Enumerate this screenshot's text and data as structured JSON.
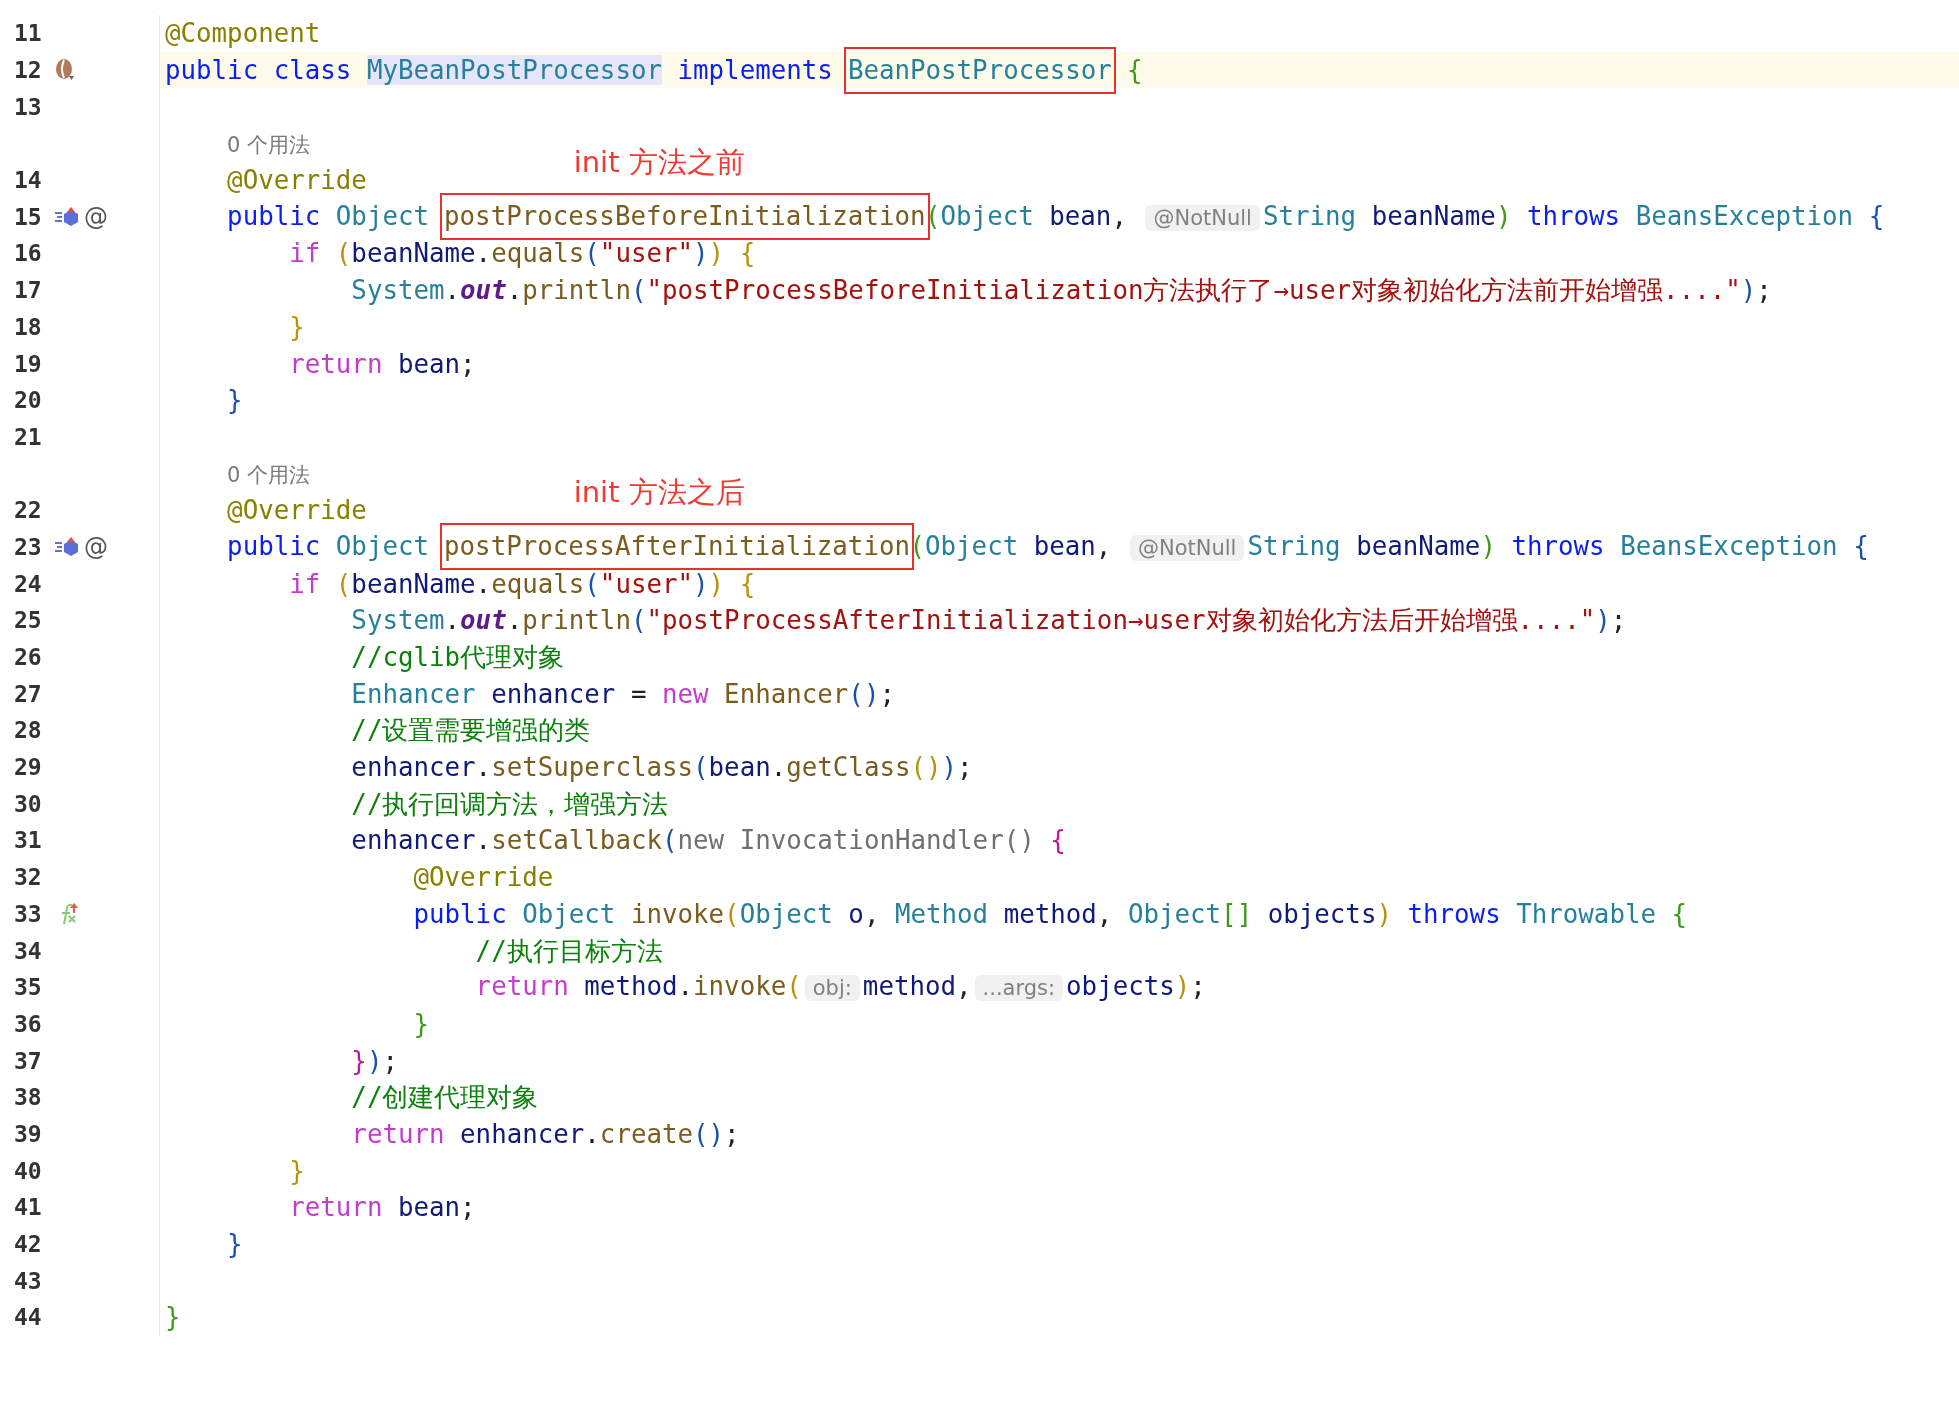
{
  "editor": {
    "lines": [
      {
        "kind": "code",
        "number": "11",
        "current": false,
        "words": [
          [
            {
              "text": "@Component",
              "kind": "ann"
            }
          ]
        ]
      },
      {
        "kind": "code",
        "number": "12",
        "current": true,
        "gutter": [
          {
            "kind": "bean"
          }
        ],
        "words": [
          [
            {
              "text": "public",
              "kind": "kw"
            }
          ],
          [
            {
              "text": "class",
              "kind": "kw"
            }
          ],
          [
            {
              "text": "MyBeanPostProcessor",
              "kind": "decl"
            }
          ],
          [
            {
              "text": "implements",
              "kind": "kw"
            }
          ],
          [
            {
              "text": "BeanPostProcessor",
              "kind": "type",
              "boxed": true
            }
          ],
          [
            {
              "text": "{",
              "kind": "green"
            }
          ]
        ],
        "children": [
          {
            "kind": "code",
            "number": "13",
            "current": false
          },
          {
            "kind": "usages",
            "current": false,
            "text": "0 个用法",
            "note": "init 方法之前"
          },
          {
            "kind": "code",
            "number": "14",
            "current": false,
            "words": [
              [
                {
                  "text": "@Override",
                  "kind": "ann"
                }
              ]
            ]
          },
          {
            "kind": "code",
            "number": "15",
            "current": false,
            "gutter": [
              {
                "kind": "implements"
              },
              {
                "kind": "text",
                "text": "@"
              }
            ],
            "words": [
              [
                {
                  "text": "public",
                  "kind": "kw"
                }
              ],
              [
                {
                  "text": "Object",
                  "kind": "type"
                }
              ],
              [
                {
                  "text": "postProcessBeforeInitialization",
                  "kind": "fn",
                  "boxed": true
                },
                {
                  "text": "(",
                  "kind": "green"
                },
                {
                  "text": "Object",
                  "kind": "type"
                }
              ],
              [
                {
                  "text": "bean",
                  "kind": "var"
                },
                {
                  "text": ",",
                  "kind": "p"
                }
              ],
              [
                {
                  "text": "@NotNull",
                  "kind": "hint"
                },
                {
                  "text": "String",
                  "kind": "type"
                }
              ],
              [
                {
                  "text": "beanName",
                  "kind": "var"
                },
                {
                  "text": ")",
                  "kind": "green"
                }
              ],
              [
                {
                  "text": "throws",
                  "kind": "kw"
                }
              ],
              [
                {
                  "text": "BeansException",
                  "kind": "type"
                }
              ],
              [
                {
                  "text": "{",
                  "kind": "blue"
                }
              ]
            ],
            "children": [
              {
                "kind": "code",
                "number": "16",
                "current": false,
                "words": [
                  [
                    {
                      "text": "if",
                      "kind": "kw2"
                    }
                  ],
                  [
                    {
                      "text": "(",
                      "kind": "gold"
                    },
                    {
                      "text": "beanName",
                      "kind": "var"
                    },
                    {
                      "text": ".",
                      "kind": "p"
                    },
                    {
                      "text": "equals",
                      "kind": "fn"
                    },
                    {
                      "text": "(",
                      "kind": "blue"
                    },
                    {
                      "text": "\"user\"",
                      "kind": "str"
                    },
                    {
                      "text": ")",
                      "kind": "blue"
                    },
                    {
                      "text": ")",
                      "kind": "gold"
                    }
                  ],
                  [
                    {
                      "text": "{",
                      "kind": "gold"
                    }
                  ]
                ],
                "children": [
                  {
                    "kind": "code",
                    "number": "17",
                    "current": false,
                    "words": [
                      [
                        {
                          "text": "System",
                          "kind": "type"
                        },
                        {
                          "text": ".",
                          "kind": "p"
                        },
                        {
                          "text": "out",
                          "kind": "stat"
                        },
                        {
                          "text": ".",
                          "kind": "p"
                        },
                        {
                          "text": "println",
                          "kind": "fn"
                        },
                        {
                          "text": "(",
                          "kind": "blue"
                        },
                        {
                          "text": "\"postProcessBeforeInitialization方法执行了→user对象初始化方法前开始增强....\"",
                          "kind": "str"
                        },
                        {
                          "text": ")",
                          "kind": "blue"
                        },
                        {
                          "text": ";",
                          "kind": "p"
                        }
                      ]
                    ]
                  }
                ]
              },
              {
                "kind": "code",
                "number": "18",
                "current": false,
                "words": [
                  [
                    {
                      "text": "}",
                      "kind": "gold"
                    }
                  ]
                ]
              },
              {
                "kind": "code",
                "number": "19",
                "current": false,
                "words": [
                  [
                    {
                      "text": "return",
                      "kind": "kw2"
                    }
                  ],
                  [
                    {
                      "text": "bean",
                      "kind": "var"
                    },
                    {
                      "text": ";",
                      "kind": "p"
                    }
                  ]
                ]
              }
            ]
          },
          {
            "kind": "code",
            "number": "20",
            "current": false,
            "words": [
              [
                {
                  "text": "}",
                  "kind": "blue"
                }
              ]
            ]
          },
          {
            "kind": "code",
            "number": "21",
            "current": false
          },
          {
            "kind": "usages",
            "current": false,
            "text": "0 个用法",
            "note": "init 方法之后"
          },
          {
            "kind": "code",
            "number": "22",
            "current": false,
            "words": [
              [
                {
                  "text": "@Override",
                  "kind": "ann"
                }
              ]
            ]
          },
          {
            "kind": "code",
            "number": "23",
            "current": false,
            "gutter": [
              {
                "kind": "implements"
              },
              {
                "kind": "text",
                "text": "@"
              }
            ],
            "words": [
              [
                {
                  "text": "public",
                  "kind": "kw"
                }
              ],
              [
                {
                  "text": "Object",
                  "kind": "type"
                }
              ],
              [
                {
                  "text": "postProcessAfterInitialization",
                  "kind": "fn",
                  "boxed": true
                },
                {
                  "text": "(",
                  "kind": "green"
                },
                {
                  "text": "Object",
                  "kind": "type"
                }
              ],
              [
                {
                  "text": "bean",
                  "kind": "var"
                },
                {
                  "text": ",",
                  "kind": "p"
                }
              ],
              [
                {
                  "text": "@NotNull",
                  "kind": "hint"
                },
                {
                  "text": "String",
                  "kind": "type"
                }
              ],
              [
                {
                  "text": "beanName",
                  "kind": "var"
                },
                {
                  "text": ")",
                  "kind": "green"
                }
              ],
              [
                {
                  "text": "throws",
                  "kind": "kw"
                }
              ],
              [
                {
                  "text": "BeansException",
                  "kind": "type"
                }
              ],
              [
                {
                  "text": "{",
                  "kind": "blue"
                }
              ]
            ],
            "children": [
              {
                "kind": "code",
                "number": "24",
                "current": false,
                "words": [
                  [
                    {
                      "text": "if",
                      "kind": "kw2"
                    }
                  ],
                  [
                    {
                      "text": "(",
                      "kind": "gold"
                    },
                    {
                      "text": "beanName",
                      "kind": "var"
                    },
                    {
                      "text": ".",
                      "kind": "p"
                    },
                    {
                      "text": "equals",
                      "kind": "fn"
                    },
                    {
                      "text": "(",
                      "kind": "blue"
                    },
                    {
                      "text": "\"user\"",
                      "kind": "str"
                    },
                    {
                      "text": ")",
                      "kind": "blue"
                    },
                    {
                      "text": ")",
                      "kind": "gold"
                    }
                  ],
                  [
                    {
                      "text": "{",
                      "kind": "gold"
                    }
                  ]
                ],
                "children": [
                  {
                    "kind": "code",
                    "number": "25",
                    "current": false,
                    "words": [
                      [
                        {
                          "text": "System",
                          "kind": "type"
                        },
                        {
                          "text": ".",
                          "kind": "p"
                        },
                        {
                          "text": "out",
                          "kind": "stat"
                        },
                        {
                          "text": ".",
                          "kind": "p"
                        },
                        {
                          "text": "println",
                          "kind": "fn"
                        },
                        {
                          "text": "(",
                          "kind": "blue"
                        },
                        {
                          "text": "\"postProcessAfterInitialization→user对象初始化方法后开始增强....\"",
                          "kind": "str"
                        },
                        {
                          "text": ")",
                          "kind": "blue"
                        },
                        {
                          "text": ";",
                          "kind": "p"
                        }
                      ]
                    ]
                  },
                  {
                    "kind": "code",
                    "number": "26",
                    "current": false,
                    "words": [
                      [
                        {
                          "text": "//cglib代理对象",
                          "kind": "cmt"
                        }
                      ]
                    ]
                  },
                  {
                    "kind": "code",
                    "number": "27",
                    "current": false,
                    "words": [
                      [
                        {
                          "text": "Enhancer",
                          "kind": "type"
                        }
                      ],
                      [
                        {
                          "text": "enhancer",
                          "kind": "var"
                        }
                      ],
                      [
                        {
                          "text": "=",
                          "kind": "p"
                        }
                      ],
                      [
                        {
                          "text": "new",
                          "kind": "kw2"
                        }
                      ],
                      [
                        {
                          "text": "Enhancer",
                          "kind": "fn"
                        },
                        {
                          "text": "()",
                          "kind": "blue"
                        },
                        {
                          "text": ";",
                          "kind": "p"
                        }
                      ]
                    ]
                  },
                  {
                    "kind": "code",
                    "number": "28",
                    "current": false,
                    "words": [
                      [
                        {
                          "text": "//设置需要增强的类",
                          "kind": "cmt"
                        }
                      ]
                    ]
                  },
                  {
                    "kind": "code",
                    "number": "29",
                    "current": false,
                    "words": [
                      [
                        {
                          "text": "enhancer",
                          "kind": "var"
                        },
                        {
                          "text": ".",
                          "kind": "p"
                        },
                        {
                          "text": "setSuperclass",
                          "kind": "fn"
                        },
                        {
                          "text": "(",
                          "kind": "blue"
                        },
                        {
                          "text": "bean",
                          "kind": "var"
                        },
                        {
                          "text": ".",
                          "kind": "p"
                        },
                        {
                          "text": "getClass",
                          "kind": "fn"
                        },
                        {
                          "text": "()",
                          "kind": "gold"
                        },
                        {
                          "text": ")",
                          "kind": "blue"
                        },
                        {
                          "text": ";",
                          "kind": "p"
                        }
                      ]
                    ]
                  },
                  {
                    "kind": "code",
                    "number": "30",
                    "current": false,
                    "words": [
                      [
                        {
                          "text": "//执行回调方法，增强方法",
                          "kind": "cmt"
                        }
                      ]
                    ]
                  },
                  {
                    "kind": "code",
                    "number": "31",
                    "current": false,
                    "words": [
                      [
                        {
                          "text": "enhancer",
                          "kind": "var"
                        },
                        {
                          "text": ".",
                          "kind": "p"
                        },
                        {
                          "text": "setCallback",
                          "kind": "fn"
                        },
                        {
                          "text": "(",
                          "kind": "blue"
                        },
                        {
                          "text": "new",
                          "kind": "gray"
                        }
                      ],
                      [
                        {
                          "text": "InvocationHandler()",
                          "kind": "gray"
                        }
                      ],
                      [
                        {
                          "text": "{",
                          "kind": "pink"
                        }
                      ]
                    ],
                    "children": [
                      {
                        "kind": "code",
                        "number": "32",
                        "current": false,
                        "words": [
                          [
                            {
                              "text": "@Override",
                              "kind": "ann"
                            }
                          ]
                        ]
                      },
                      {
                        "kind": "code",
                        "number": "33",
                        "current": false,
                        "gutter": [
                          {
                            "kind": "lambda"
                          }
                        ],
                        "words": [
                          [
                            {
                              "text": "public",
                              "kind": "kw"
                            }
                          ],
                          [
                            {
                              "text": "Object",
                              "kind": "type"
                            }
                          ],
                          [
                            {
                              "text": "invoke",
                              "kind": "fn"
                            },
                            {
                              "text": "(",
                              "kind": "gold"
                            },
                            {
                              "text": "Object",
                              "kind": "type"
                            }
                          ],
                          [
                            {
                              "text": "o",
                              "kind": "var"
                            },
                            {
                              "text": ",",
                              "kind": "p"
                            }
                          ],
                          [
                            {
                              "text": "Method",
                              "kind": "type"
                            }
                          ],
                          [
                            {
                              "text": "method",
                              "kind": "var"
                            },
                            {
                              "text": ",",
                              "kind": "p"
                            }
                          ],
                          [
                            {
                              "text": "Object",
                              "kind": "type"
                            },
                            {
                              "text": "[]",
                              "kind": "green"
                            }
                          ],
                          [
                            {
                              "text": "objects",
                              "kind": "var"
                            },
                            {
                              "text": ")",
                              "kind": "gold"
                            }
                          ],
                          [
                            {
                              "text": "throws",
                              "kind": "kw"
                            }
                          ],
                          [
                            {
                              "text": "Throwable",
                              "kind": "type"
                            }
                          ],
                          [
                            {
                              "text": "{",
                              "kind": "green"
                            }
                          ]
                        ],
                        "children": [
                          {
                            "kind": "code",
                            "number": "34",
                            "current": false,
                            "words": [
                              [
                                {
                                  "text": "//执行目标方法",
                                  "kind": "cmt"
                                }
                              ]
                            ]
                          },
                          {
                            "kind": "code",
                            "number": "35",
                            "current": false,
                            "words": [
                              [
                                {
                                  "text": "return",
                                  "kind": "kw2"
                                }
                              ],
                              [
                                {
                                  "text": "method",
                                  "kind": "var"
                                },
                                {
                                  "text": ".",
                                  "kind": "p"
                                },
                                {
                                  "text": "invoke",
                                  "kind": "fn"
                                },
                                {
                                  "text": "(",
                                  "kind": "gold"
                                },
                                {
                                  "text": "obj:",
                                  "kind": "hint"
                                },
                                {
                                  "text": "method",
                                  "kind": "var"
                                },
                                {
                                  "text": ",",
                                  "kind": "p"
                                },
                                {
                                  "text": "...args:",
                                  "kind": "hint"
                                },
                                {
                                  "text": "objects",
                                  "kind": "var"
                                },
                                {
                                  "text": ")",
                                  "kind": "gold"
                                },
                                {
                                  "text": ";",
                                  "kind": "p"
                                }
                              ]
                            ]
                          }
                        ]
                      },
                      {
                        "kind": "code",
                        "number": "36",
                        "current": false,
                        "words": [
                          [
                            {
                              "text": "}",
                              "kind": "green"
                            }
                          ]
                        ]
                      }
                    ]
                  },
                  {
                    "kind": "code",
                    "number": "37",
                    "current": false,
                    "words": [
                      [
                        {
                          "text": "}",
                          "kind": "pink"
                        },
                        {
                          "text": ")",
                          "kind": "blue"
                        },
                        {
                          "text": ";",
                          "kind": "p"
                        }
                      ]
                    ]
                  },
                  {
                    "kind": "code",
                    "number": "38",
                    "current": false,
                    "words": [
                      [
                        {
                          "text": "//创建代理对象",
                          "kind": "cmt"
                        }
                      ]
                    ]
                  },
                  {
                    "kind": "code",
                    "number": "39",
                    "current": false,
                    "words": [
                      [
                        {
                          "text": "return",
                          "kind": "kw2"
                        }
                      ],
                      [
                        {
                          "text": "enhancer",
                          "kind": "var"
                        },
                        {
                          "text": ".",
                          "kind": "p"
                        },
                        {
                          "text": "create",
                          "kind": "fn"
                        },
                        {
                          "text": "()",
                          "kind": "blue"
                        },
                        {
                          "text": ";",
                          "kind": "p"
                        }
                      ]
                    ]
                  }
                ]
              },
              {
                "kind": "code",
                "number": "40",
                "current": false,
                "words": [
                  [
                    {
                      "text": "}",
                      "kind": "gold"
                    }
                  ]
                ]
              },
              {
                "kind": "code",
                "number": "41",
                "current": false,
                "words": [
                  [
                    {
                      "text": "return",
                      "kind": "kw2"
                    }
                  ],
                  [
                    {
                      "text": "bean",
                      "kind": "var"
                    },
                    {
                      "text": ";",
                      "kind": "p"
                    }
                  ]
                ]
              }
            ]
          },
          {
            "kind": "code",
            "number": "42",
            "current": false,
            "words": [
              [
                {
                  "text": "}",
                  "kind": "blue"
                }
              ]
            ]
          },
          {
            "kind": "code",
            "number": "43",
            "current": false
          }
        ]
      },
      {
        "kind": "code",
        "number": "44",
        "current": false,
        "words": [
          [
            {
              "text": "}",
              "kind": "green"
            }
          ]
        ]
      }
    ]
  }
}
